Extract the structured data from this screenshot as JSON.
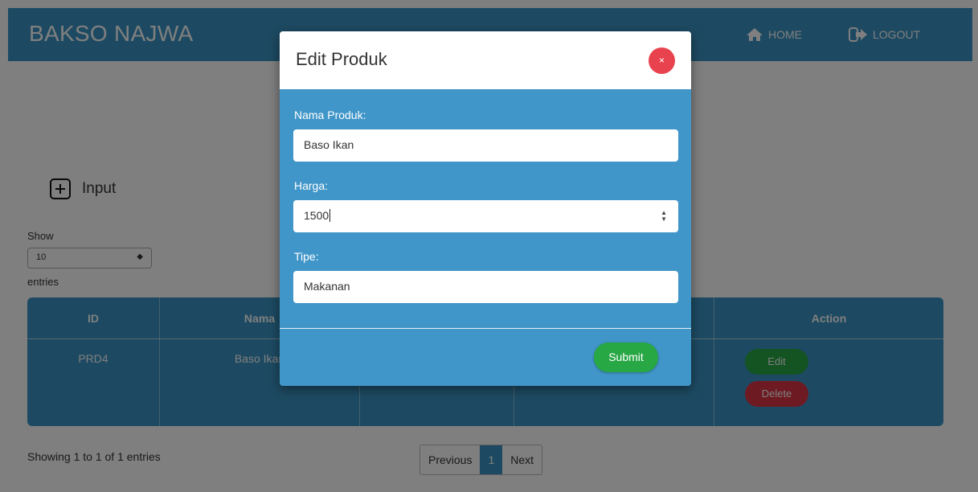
{
  "navbar": {
    "brand": "BAKSO NAJWA",
    "home_label": "HOME",
    "logout_label": "LOGOUT",
    "home_icon": "home-icon",
    "logout_icon": "logout-icon"
  },
  "toolbar": {
    "input_label": "Input",
    "input_icon": "plus-square-icon"
  },
  "table_controls": {
    "show_label": "Show",
    "page_size": "10",
    "entries_label": "entries"
  },
  "table": {
    "columns": [
      "ID",
      "Nama",
      "",
      "",
      "Action"
    ],
    "rows": [
      {
        "id": "PRD4",
        "nama": "Baso Ikan",
        "col3": "",
        "col4": "",
        "edit_label": "Edit",
        "delete_label": "Delete"
      }
    ]
  },
  "footer": {
    "info": "Showing 1 to 1 of 1 entries",
    "previous_label": "Previous",
    "current_page": "1",
    "next_label": "Next"
  },
  "modal": {
    "title": "Edit Produk",
    "close_label": "×",
    "fields": [
      {
        "label": "Nama Produk:",
        "value": "Baso Ikan"
      },
      {
        "label": "Harga:",
        "value": "1500"
      },
      {
        "label": "Tipe:",
        "value": "Makanan"
      }
    ],
    "submit_label": "Submit"
  },
  "colors": {
    "primary": "#3a95c5",
    "success": "#28a745",
    "danger": "#dc3545"
  }
}
